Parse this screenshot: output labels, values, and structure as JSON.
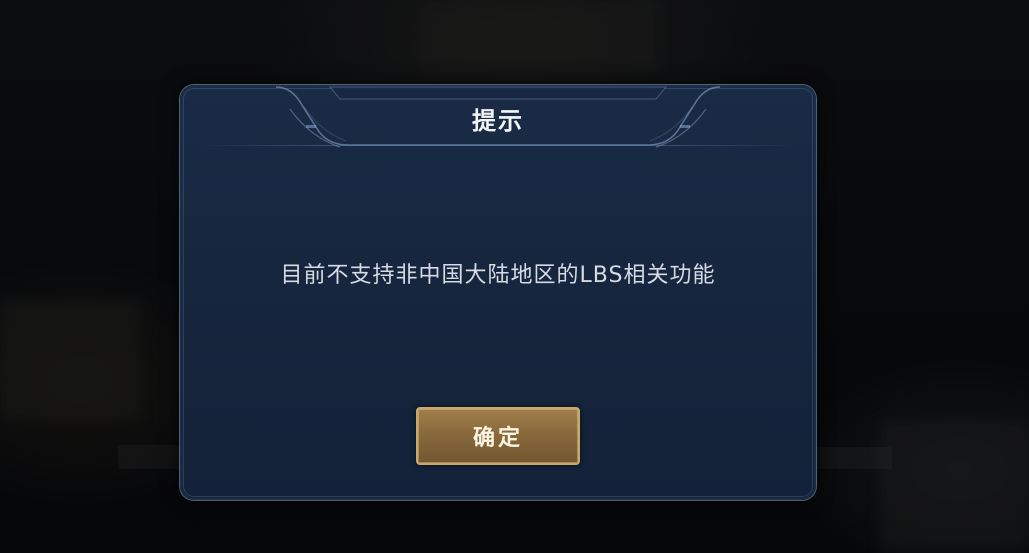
{
  "dialog": {
    "title": "提示",
    "message": "目前不支持非中国大陆地区的LBS相关功能",
    "confirm_label": "确定"
  },
  "colors": {
    "dialog_bg": "#172740",
    "dialog_border": "#8caad2",
    "button_gold": "#8a6a3c",
    "button_border": "#c8a96a",
    "title_text": "#f2f4f8",
    "message_text": "#d6dbe4"
  }
}
